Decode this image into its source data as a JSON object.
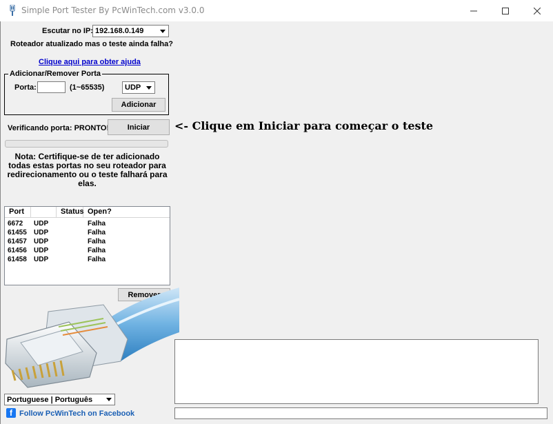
{
  "window": {
    "title": "Simple Port Tester By PcWinTech.com v3.0.0"
  },
  "listen": {
    "label": "Escutar no IP:",
    "ip_value": "192.168.0.149"
  },
  "router_question": "Roteador atualizado mas o teste ainda falha?",
  "help_link": "Clique aqui para obter ajuda",
  "port_group": {
    "title": "Adicionar/Remover Porta",
    "port_label": "Porta:",
    "port_value": "",
    "range_hint": "(1~65535)",
    "protocol_value": "UDP",
    "add_button": "Adicionar"
  },
  "status": {
    "label": "Verificando porta: PRONTO!",
    "start_button": "Iniciar",
    "hint": "<- Clique em Iniciar para começar o teste",
    "progress": 0
  },
  "note": "Nota: Certifique-se de ter adicionado todas estas portas no seu roteador para redirecionamento ou o teste falhará para elas.",
  "ports_table": {
    "columns": [
      "Port",
      "",
      "Status",
      "Open?"
    ],
    "rows": [
      {
        "port": "6672",
        "proto": "UDP",
        "status": "",
        "open": "Falha"
      },
      {
        "port": "61455",
        "proto": "UDP",
        "status": "",
        "open": "Falha"
      },
      {
        "port": "61457",
        "proto": "UDP",
        "status": "",
        "open": "Falha"
      },
      {
        "port": "61456",
        "proto": "UDP",
        "status": "",
        "open": "Falha"
      },
      {
        "port": "61458",
        "proto": "UDP",
        "status": "",
        "open": "Falha"
      }
    ]
  },
  "remove_button": "Remover",
  "language": {
    "value": "Portuguese | Português"
  },
  "facebook": {
    "label": "Follow PcWinTech on Facebook",
    "icon_glyph": "f"
  },
  "log_text": "",
  "status_bar_text": "",
  "colors": {
    "link": "#0000cc",
    "facebook_blue": "#1877f2",
    "window_bg": "#f0f0f0"
  }
}
